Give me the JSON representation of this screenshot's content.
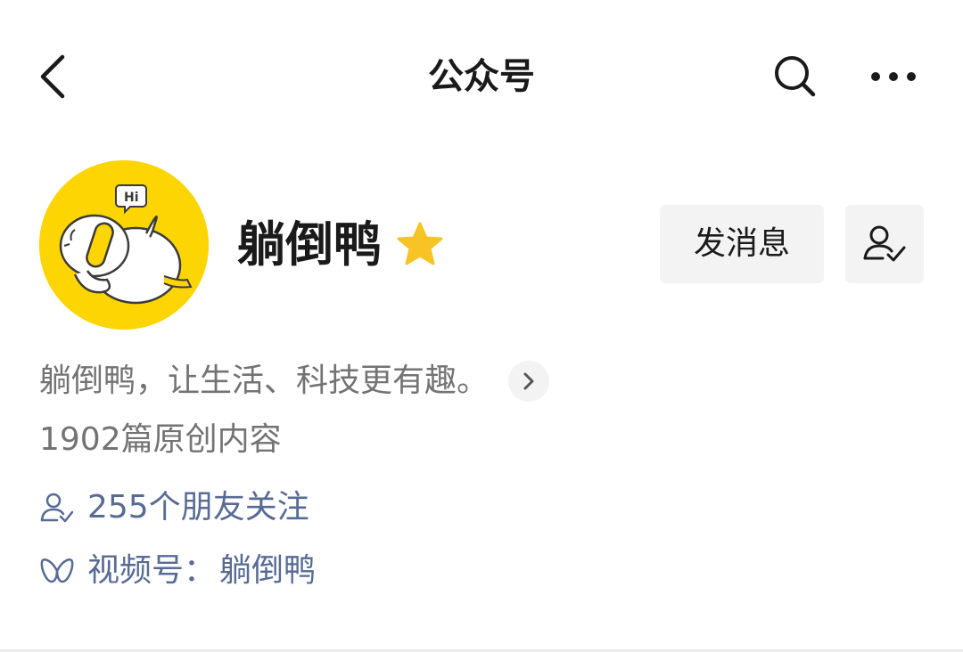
{
  "nav": {
    "title": "公众号",
    "back_icon": "chevron-left-icon",
    "search_icon": "search-icon",
    "more_icon": "more-dots-icon"
  },
  "profile": {
    "name": "躺倒鸭",
    "badge_icon": "star-icon",
    "avatar_text": "Hi",
    "message_button": "发消息",
    "follow_icon": "followed-user-icon"
  },
  "info": {
    "bio": "躺倒鸭，让生活、科技更有趣。",
    "articles": "1902篇原创内容",
    "friends": "255个朋友关注",
    "channels_label": "视频号：",
    "channels_name": "躺倒鸭"
  },
  "colors": {
    "accent_link": "#576b95",
    "avatar_bg": "#fcd503",
    "star": "#f7c325",
    "muted_text": "#737373",
    "button_bg": "#f3f3f3"
  }
}
